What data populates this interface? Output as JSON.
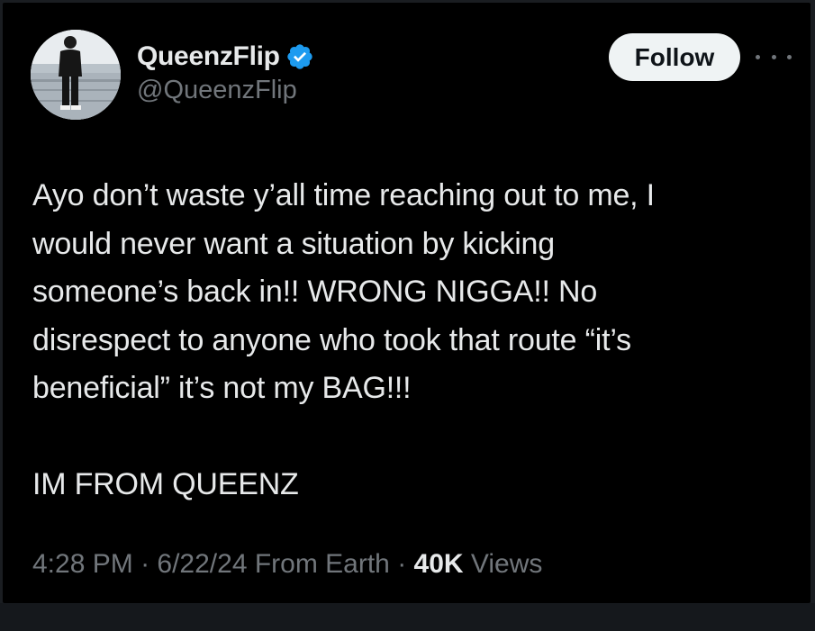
{
  "user": {
    "display_name": "QueenzFlip",
    "handle": "@QueenzFlip",
    "verified": true,
    "avatar_icon": "profile-photo"
  },
  "actions": {
    "follow_label": "Follow",
    "more_icon": "more-horizontal-icon"
  },
  "tweet": {
    "lines": [
      "Ayo don’t waste y’all time reaching out to me, I",
      "would never want a situation by kicking",
      "someone’s back in!! WRONG NIGGA!! No",
      "disrespect to anyone who took that route “it’s",
      "beneficial” it’s not my BAG!!!"
    ],
    "closing": "IM FROM QUEENZ"
  },
  "meta": {
    "time": "4:28 PM",
    "separator1": " · ",
    "date": "6/22/24",
    "location": " From Earth",
    "separator2": " · ",
    "views_count": "40K",
    "views_label": " Views"
  },
  "colors": {
    "background": "#000000",
    "text": "#e7e9ea",
    "secondary": "#71767b",
    "verified": "#1d9bf0",
    "follow_bg": "#eff3f4"
  }
}
